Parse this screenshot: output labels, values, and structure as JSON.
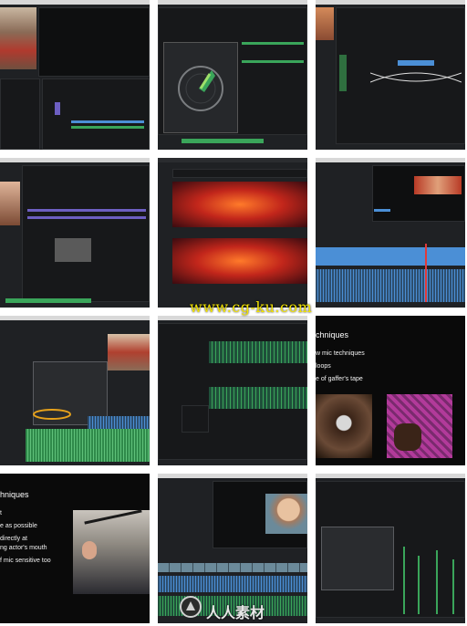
{
  "watermarks": {
    "site": "www.cg-ku.com",
    "logo_text": "人人素材"
  },
  "slides": {
    "left": {
      "title": "chniques",
      "bullets": [
        "w mic techniques",
        "loops",
        "e of gaffer's tape"
      ]
    },
    "right": {
      "title": "hniques",
      "bullets": [
        "t",
        "e as possible",
        "directly at",
        "ng actor's mouth",
        "f mic sensitive too"
      ]
    }
  },
  "colors": {
    "tile_bg": "#1f2124",
    "timeline_blue": "#4b8fd6",
    "timeline_green": "#3aa55a",
    "spectral_red": "#c2261b",
    "watermark_yellow": "#f2e300"
  }
}
